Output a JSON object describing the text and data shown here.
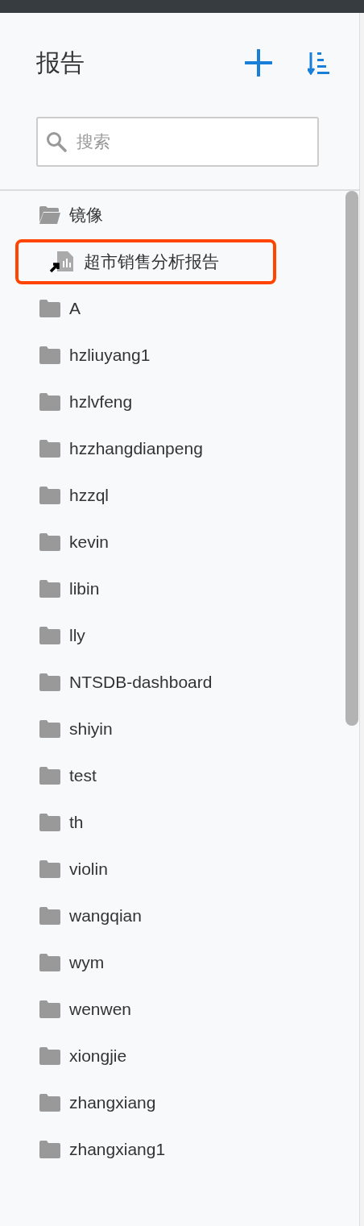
{
  "title": "报告",
  "search": {
    "placeholder": "搜索"
  },
  "tree": [
    {
      "name": "镜像",
      "kind": "folder",
      "expanded": true,
      "selected": false,
      "children": [
        {
          "name": "超市销售分析报告",
          "kind": "report-shortcut",
          "selected": true
        }
      ]
    },
    {
      "name": "A",
      "kind": "folder",
      "expanded": false,
      "selected": false
    },
    {
      "name": "hzliuyang1",
      "kind": "folder",
      "expanded": false,
      "selected": false
    },
    {
      "name": "hzlvfeng",
      "kind": "folder",
      "expanded": false,
      "selected": false
    },
    {
      "name": "hzzhangdianpeng",
      "kind": "folder",
      "expanded": false,
      "selected": false
    },
    {
      "name": "hzzql",
      "kind": "folder",
      "expanded": false,
      "selected": false
    },
    {
      "name": "kevin",
      "kind": "folder",
      "expanded": false,
      "selected": false
    },
    {
      "name": "libin",
      "kind": "folder",
      "expanded": false,
      "selected": false
    },
    {
      "name": "lly",
      "kind": "folder",
      "expanded": false,
      "selected": false
    },
    {
      "name": "NTSDB-dashboard",
      "kind": "folder",
      "expanded": false,
      "selected": false
    },
    {
      "name": "shiyin",
      "kind": "folder",
      "expanded": false,
      "selected": false
    },
    {
      "name": "test",
      "kind": "folder",
      "expanded": false,
      "selected": false
    },
    {
      "name": "th",
      "kind": "folder",
      "expanded": false,
      "selected": false
    },
    {
      "name": "violin",
      "kind": "folder",
      "expanded": false,
      "selected": false
    },
    {
      "name": "wangqian",
      "kind": "folder",
      "expanded": false,
      "selected": false
    },
    {
      "name": "wym",
      "kind": "folder",
      "expanded": false,
      "selected": false
    },
    {
      "name": "wenwen",
      "kind": "folder",
      "expanded": false,
      "selected": false
    },
    {
      "name": "xiongjie",
      "kind": "folder",
      "expanded": false,
      "selected": false
    },
    {
      "name": "zhangxiang",
      "kind": "folder",
      "expanded": false,
      "selected": false
    },
    {
      "name": "zhangxiang1",
      "kind": "folder",
      "expanded": false,
      "selected": false
    }
  ]
}
